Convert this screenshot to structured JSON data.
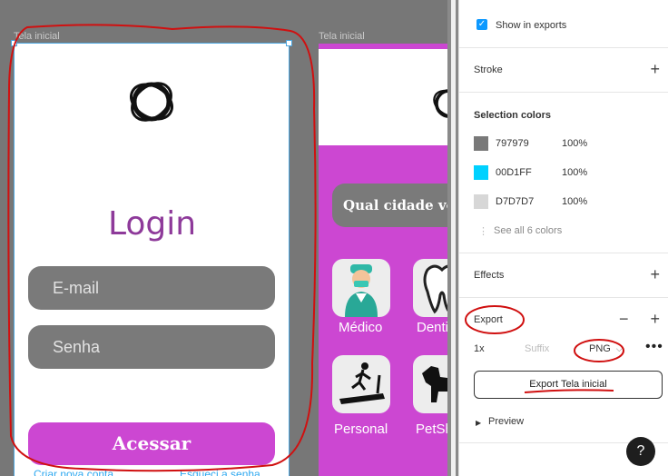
{
  "canvas": {
    "frames": [
      {
        "label": "Tela inicial",
        "title": "Login",
        "email_placeholder": "E-mail",
        "password_placeholder": "Senha",
        "submit_label": "Acessar",
        "create_account_link": "Criar nova conta",
        "forgot_password_link": "Esqueci a senha"
      },
      {
        "label": "Tela inicial",
        "search_placeholder": "Qual cidade você",
        "categories": [
          {
            "label": "Médico",
            "icon": "doctor-icon"
          },
          {
            "label": "Dentista",
            "icon": "tooth-icon"
          },
          {
            "label": "Personal",
            "icon": "treadmill-icon"
          },
          {
            "label": "PetShop",
            "icon": "dog-icon"
          }
        ]
      }
    ]
  },
  "panel": {
    "show_in_exports": {
      "label": "Show in exports",
      "checked": true
    },
    "stroke": {
      "title": "Stroke"
    },
    "selection_colors": {
      "title": "Selection colors",
      "colors": [
        {
          "hex": "797979",
          "opacity": "100%",
          "swatch": "#797979"
        },
        {
          "hex": "00D1FF",
          "opacity": "100%",
          "swatch": "#00D1FF"
        },
        {
          "hex": "D7D7D7",
          "opacity": "100%",
          "swatch": "#D7D7D7"
        }
      ],
      "see_all": "See all 6 colors"
    },
    "effects": {
      "title": "Effects"
    },
    "export": {
      "title": "Export",
      "scale": "1x",
      "suffix_placeholder": "Suffix",
      "format": "PNG",
      "button_label": "Export Tela inicial",
      "preview_label": "Preview"
    },
    "help_label": "?"
  },
  "colors": {
    "canvas_bg": "#777777",
    "accent_purple": "#cc47d2",
    "title_purple": "#8e3a9a",
    "annotation_red": "#d01010",
    "figma_blue": "#0d99ff"
  }
}
